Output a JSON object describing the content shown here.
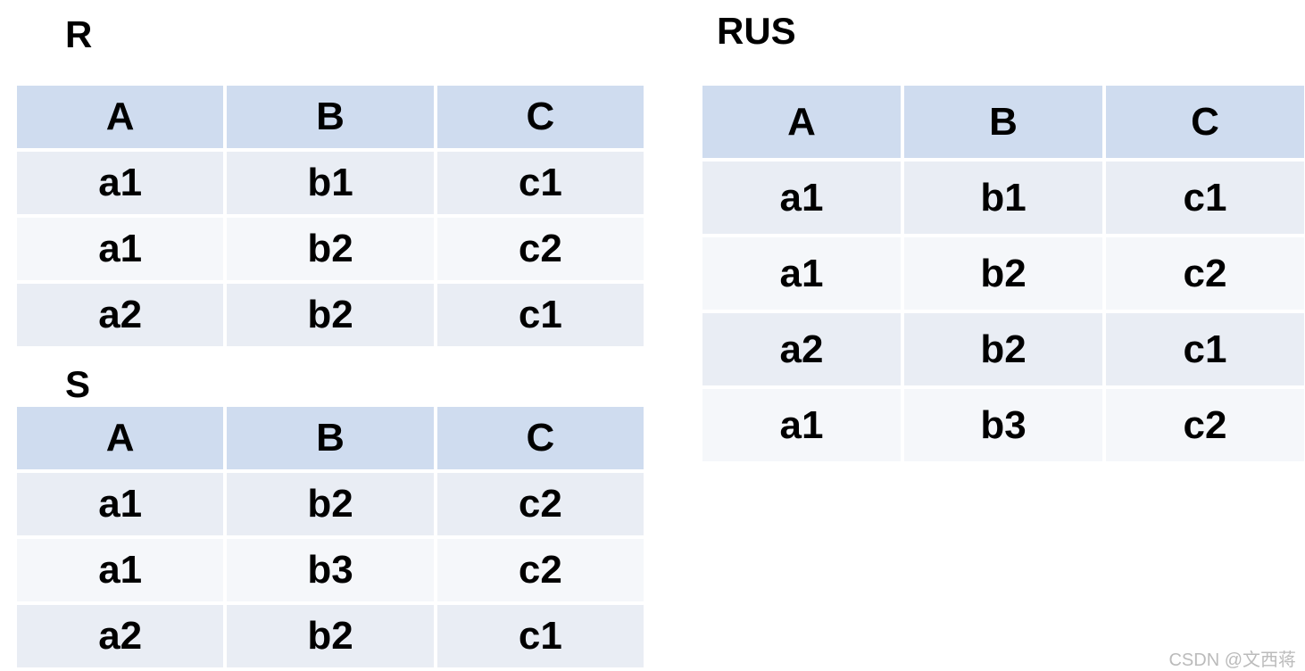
{
  "tables": {
    "R": {
      "title": "R",
      "headers": [
        "A",
        "B",
        "C"
      ],
      "rows": [
        [
          "a1",
          "b1",
          "c1"
        ],
        [
          "a1",
          "b2",
          "c2"
        ],
        [
          "a2",
          "b2",
          "c1"
        ]
      ]
    },
    "S": {
      "title": "S",
      "headers": [
        "A",
        "B",
        "C"
      ],
      "rows": [
        [
          "a1",
          "b2",
          "c2"
        ],
        [
          "a1",
          "b3",
          "c2"
        ],
        [
          "a2",
          "b2",
          "c1"
        ]
      ]
    },
    "RUS": {
      "title": "RUS",
      "headers": [
        "A",
        "B",
        "C"
      ],
      "rows": [
        [
          "a1",
          "b1",
          "c1"
        ],
        [
          "a1",
          "b2",
          "c2"
        ],
        [
          "a2",
          "b2",
          "c1"
        ],
        [
          "a1",
          "b3",
          "c2"
        ]
      ]
    }
  },
  "watermark": "CSDN @文西蒋",
  "colors": {
    "header_bg": "#cfdcef",
    "row_odd_bg": "#e9edf4",
    "row_even_bg": "#f5f7fa"
  }
}
